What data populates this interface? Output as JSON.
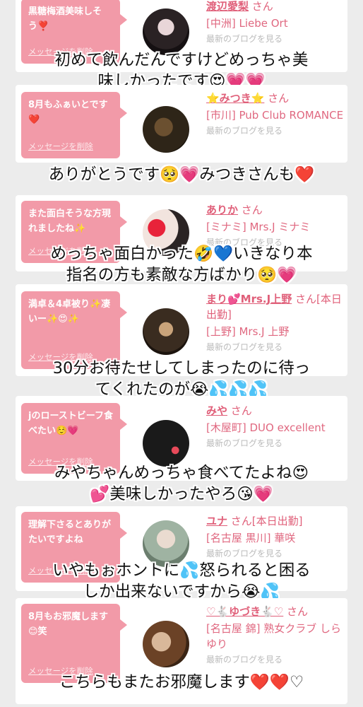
{
  "items": [
    {
      "bubble": "黒糖梅酒美味しそう❣️",
      "delete": "メッセージを削除",
      "name": "渡辺愛梨",
      "san": "さん",
      "shop": "[中洲] Liebe Ort",
      "blog": "最新のブログを見る",
      "caption": "初めて飲んだんですけどめっちゃ美味しかったです😍💗💗"
    },
    {
      "bubble": "8月もふぁいとです❤️",
      "delete": "メッセージを削除",
      "name": "⭐️みつき⭐️",
      "san": "さん",
      "shop": "[市川] Pub Club ROMANCE",
      "blog": "最新のブログを見る",
      "caption": "ありがとうです🥺💗みつきさんも❤️"
    },
    {
      "bubble": "また面白そうな方現れましたね✨",
      "delete": "メッセージを削除",
      "name": "ありか",
      "san": "さん",
      "shop": "[ミナミ] Mrs.J ミナミ",
      "blog": "最新のブログを見る",
      "caption": "めっちゃ面白かった🤣💙いきなり本指名の方も素敵な方ばかり🥺💗"
    },
    {
      "bubble": "満卓＆4卓被り✨凄いー✨😍✨",
      "delete": "メッセージを削除",
      "name": "まり💕Mrs.J上野",
      "san": "さん[本日出勤]",
      "shop": "[上野] Mrs.J 上野",
      "blog": "最新のブログを見る",
      "caption": "30分お待たせしてしまったのに待ってくれたのが😭💦💦💦"
    },
    {
      "bubble": "jのローストビーフ食べたい☺️💗",
      "delete": "メッセージを削除",
      "name": "みや",
      "san": "さん",
      "shop": "[木屋町] DUO excellent",
      "blog": "最新のブログを見る",
      "caption": "みやちゃんめっちゃ食べてたよね😍💕美味しかったやろ😘💗"
    },
    {
      "bubble": "理解下さるとありがたいですよね",
      "delete": "メッセージを削除",
      "name": "ユナ",
      "san": "さん[本日出勤]",
      "shop": "[名古屋 黒川] 華咲",
      "blog": "最新のブログを見る",
      "caption": "いやもぉホントに💦怒られると困るしか出来ないですから😭💦"
    },
    {
      "bubble": "8月もお邪魔します😊笑",
      "delete": "メッセージを削除",
      "name": "♡🐇ゆづき🐇♡",
      "san": "さん",
      "shop": "[名古屋 錦] 熟女クラブ しらゆり",
      "blog": "最新のブログを見る",
      "caption": "こちらもまたお邪魔します❤️❤️♡"
    }
  ],
  "colors": {
    "bubble": "#f29aa8",
    "name": "#e0607a",
    "background": "#ececec"
  }
}
